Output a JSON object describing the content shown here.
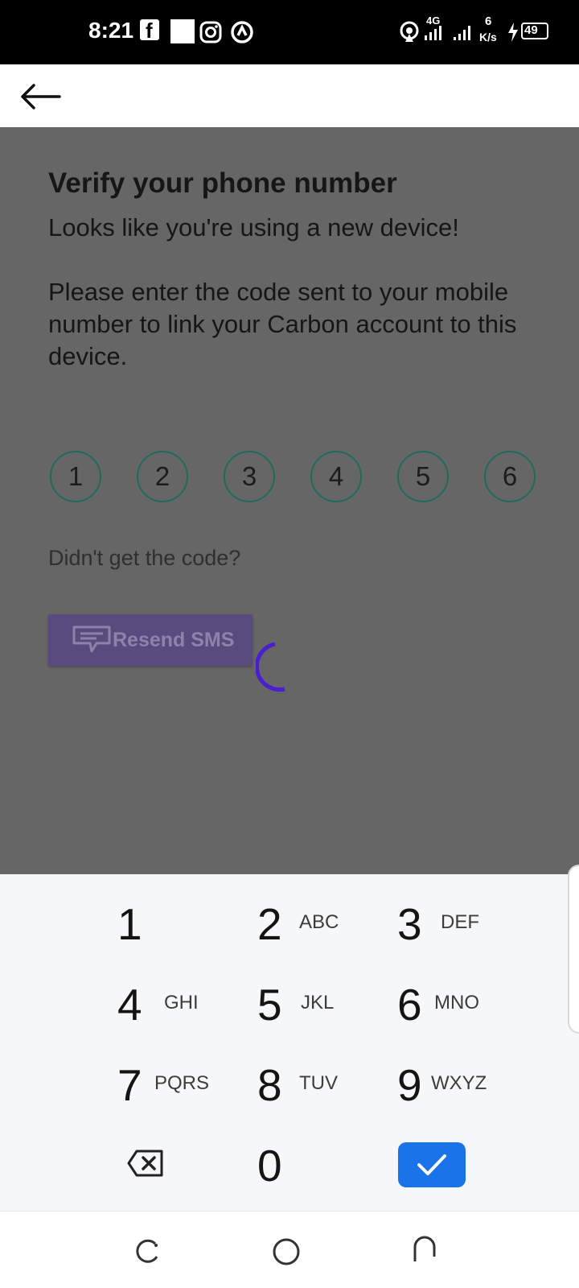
{
  "status_bar": {
    "time": "8:21",
    "network": "4G",
    "speed_value": "6",
    "speed_unit": "K/s",
    "battery": "49",
    "icons": [
      "facebook-icon",
      "notification-square-icon",
      "instagram-icon",
      "at-sign-icon",
      "hotspot-icon",
      "signal-4g-icon",
      "signal-icon",
      "charging-icon",
      "battery-icon"
    ]
  },
  "app_bar": {
    "back_icon": "arrow-left-icon"
  },
  "verify": {
    "title": "Verify your phone number",
    "subtitle": "Looks like you're using a new device!",
    "instructions": "Please enter the code sent to your mobile number to link your Carbon account to this device.",
    "code_digits": [
      "1",
      "2",
      "3",
      "4",
      "5",
      "6"
    ],
    "didnt_get_code": "Didn't get the code?",
    "resend_label": "Resend SMS",
    "resend_icon": "message-icon"
  },
  "keypad": {
    "keys": [
      {
        "digit": "1",
        "letters": ""
      },
      {
        "digit": "2",
        "letters": "ABC"
      },
      {
        "digit": "3",
        "letters": "DEF"
      },
      {
        "digit": "4",
        "letters": "GHI"
      },
      {
        "digit": "5",
        "letters": "JKL"
      },
      {
        "digit": "6",
        "letters": "MNO"
      },
      {
        "digit": "7",
        "letters": "PQRS"
      },
      {
        "digit": "8",
        "letters": "TUV"
      },
      {
        "digit": "9",
        "letters": "WXYZ"
      },
      {
        "digit": "0",
        "letters": ""
      }
    ],
    "backspace_icon": "backspace-icon",
    "confirm_icon": "checkmark-icon"
  },
  "nav_bar": {
    "icons": [
      "recent-apps-icon",
      "home-icon",
      "back-nav-icon"
    ]
  },
  "colors": {
    "overlay": "#666666",
    "accent_teal": "#1e6b5b",
    "resend_bg": "#594b7e",
    "spinner": "#4a1fd1",
    "confirm": "#1a73e8",
    "keypad_bg": "#f6f7f9"
  }
}
